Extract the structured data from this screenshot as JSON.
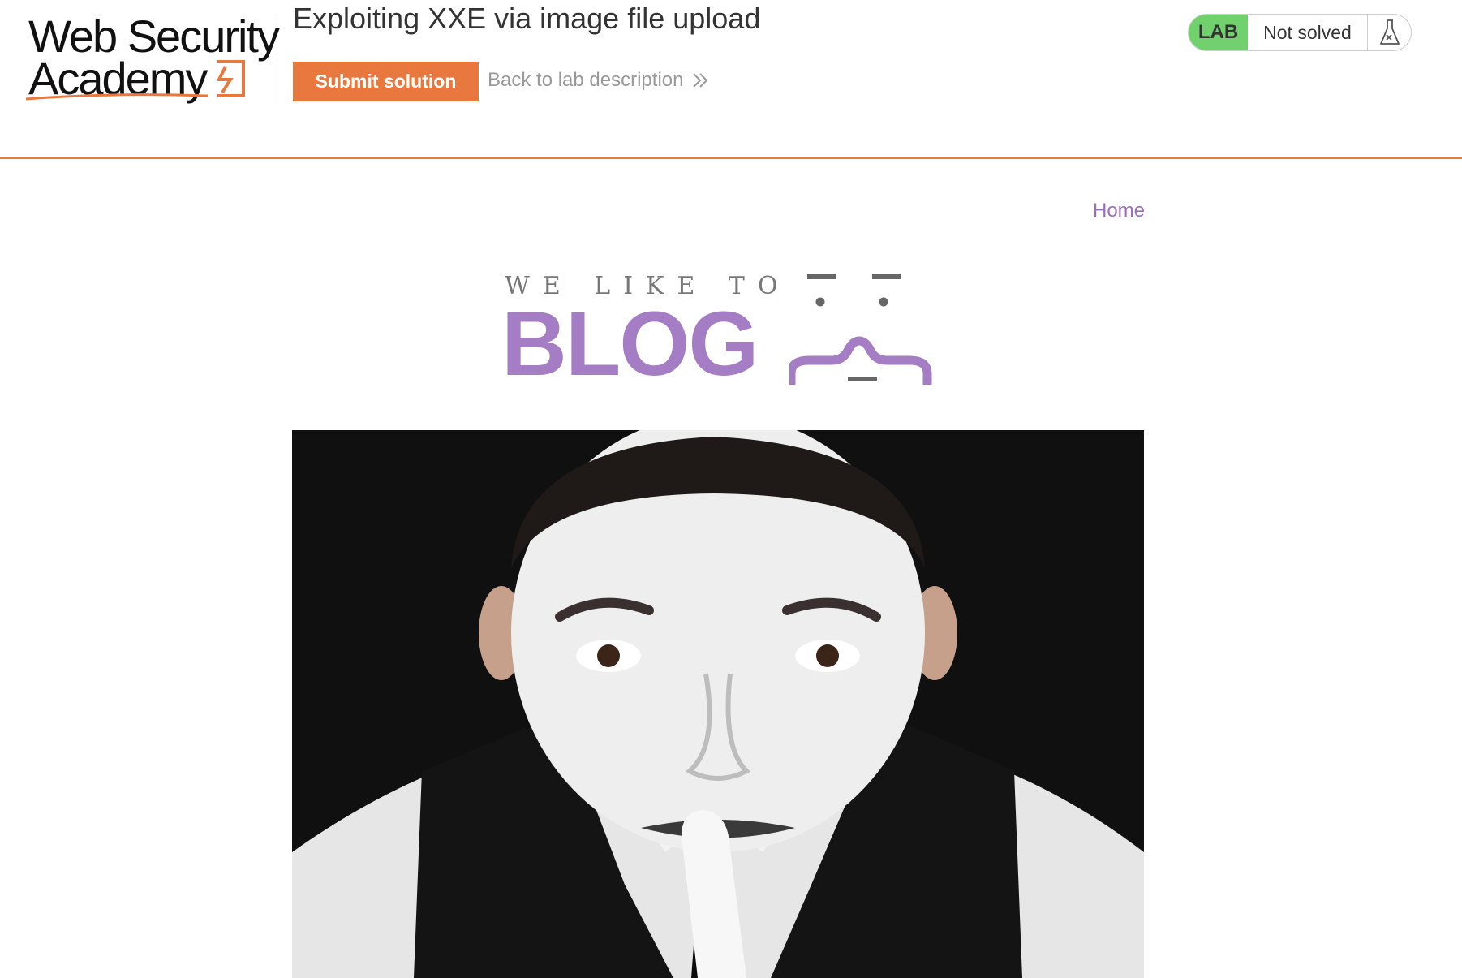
{
  "academy_header": {
    "logo": {
      "line1": "Web Security",
      "line2": "Academy"
    },
    "lab_title": "Exploiting XXE via image file upload",
    "submit_label": "Submit solution",
    "back_label": "Back to lab description",
    "lab_badge": {
      "label": "LAB",
      "status": "Not solved"
    }
  },
  "blog": {
    "nav": {
      "home_label": "Home"
    },
    "banner": {
      "tagline": "WE LIKE TO",
      "word": "BLOG"
    }
  },
  "icons": {
    "logo_mark": "lightning-bolt-icon",
    "back_chevron": "double-chevron-right-icon",
    "lab_flask": "flask-icon",
    "banner_face": "curly-brace-face-icon"
  },
  "colors": {
    "accent_orange": "#e9783f",
    "lab_green": "#70d16d",
    "blog_purple": "#a57dc5",
    "link_purple": "#9b6ec1"
  }
}
